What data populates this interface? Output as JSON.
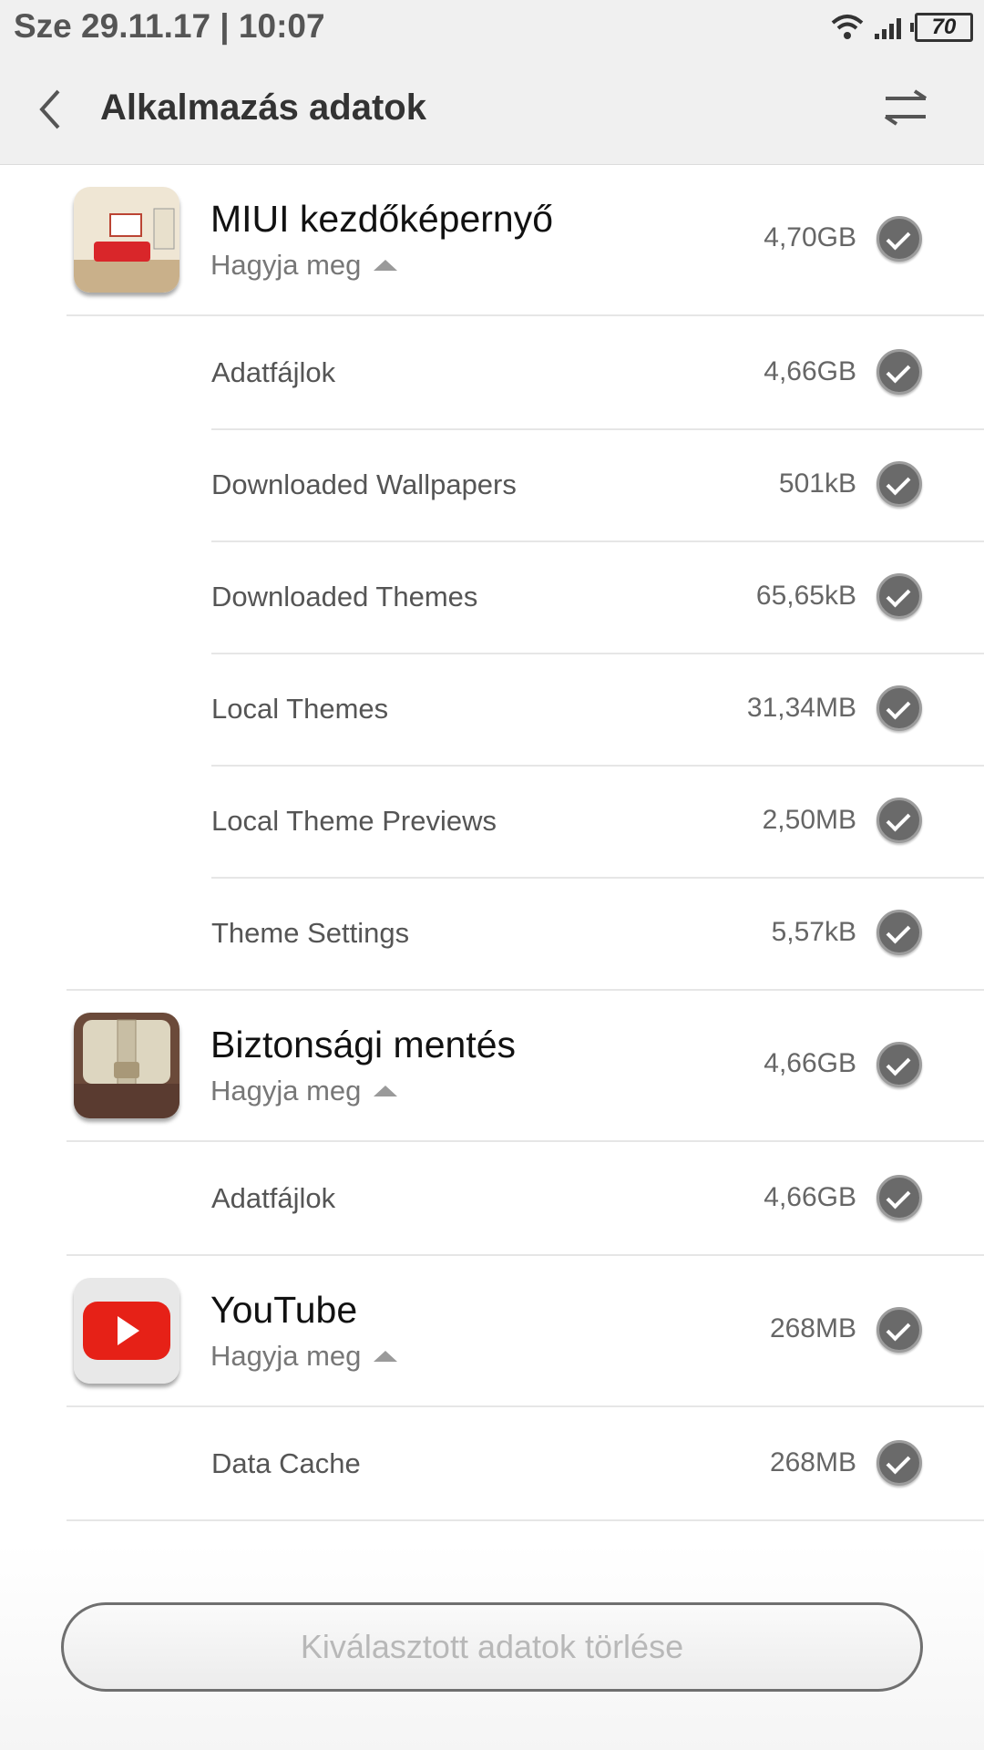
{
  "status_bar": {
    "time": "Sze 29.11.17 | 10:07",
    "battery": "70"
  },
  "header": {
    "title": "Alkalmazás adatok"
  },
  "apps": [
    {
      "name": "MIUI kezdőképernyő",
      "sub": "Hagyja meg",
      "size": "4,70GB",
      "items": [
        {
          "label": "Adatfájlok",
          "size": "4,66GB"
        },
        {
          "label": "Downloaded Wallpapers",
          "size": "501kB"
        },
        {
          "label": "Downloaded Themes",
          "size": "65,65kB"
        },
        {
          "label": "Local Themes",
          "size": "31,34MB"
        },
        {
          "label": "Local Theme Previews",
          "size": "2,50MB"
        },
        {
          "label": "Theme Settings",
          "size": "5,57kB"
        }
      ]
    },
    {
      "name": "Biztonsági mentés",
      "sub": "Hagyja meg",
      "size": "4,66GB",
      "items": [
        {
          "label": "Adatfájlok",
          "size": "4,66GB"
        }
      ]
    },
    {
      "name": "YouTube",
      "sub": "Hagyja meg",
      "size": "268MB",
      "items": [
        {
          "label": "Data Cache",
          "size": "268MB"
        }
      ]
    }
  ],
  "footer": {
    "delete_label": "Kiválasztott adatok  törlése"
  },
  "icons": {
    "back": "chevron-left-icon",
    "sort": "sort-arrows-icon",
    "check": "check-circle-icon"
  },
  "colors": {
    "youtube_red": "#e62117",
    "check_grey": "#6a6a6a"
  }
}
